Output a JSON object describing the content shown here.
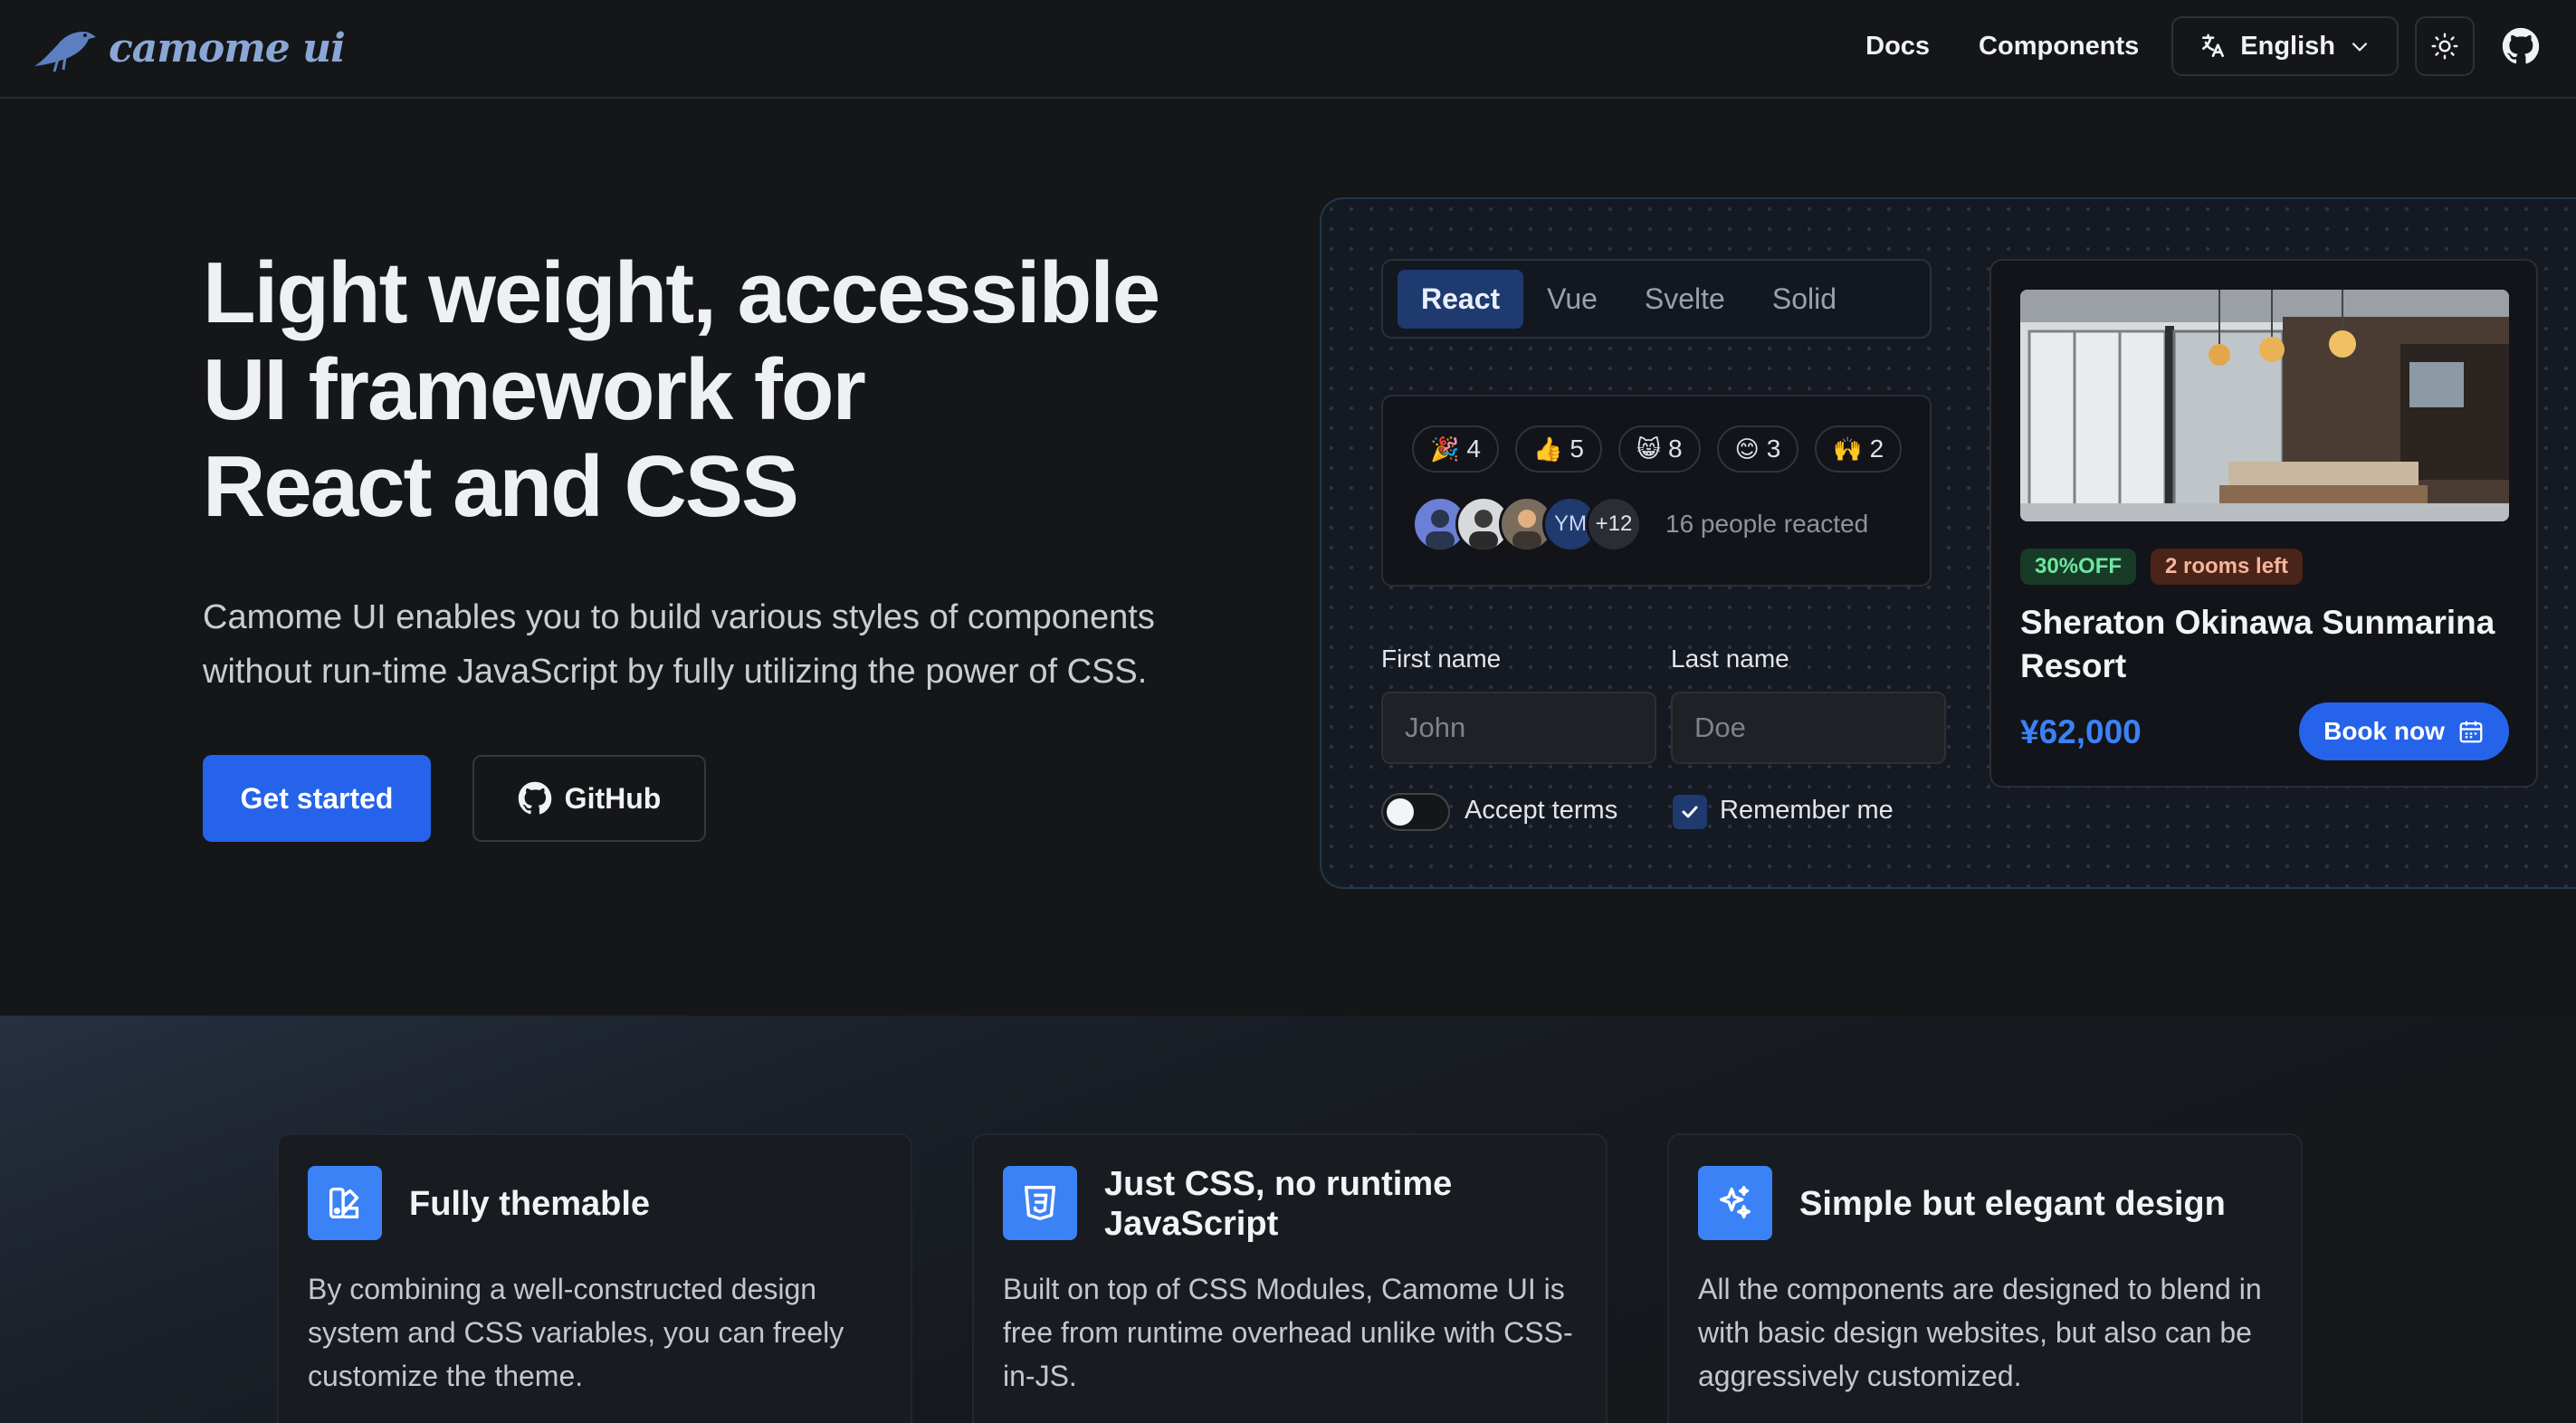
{
  "header": {
    "logo_text": "camome ui",
    "nav": {
      "docs": "Docs",
      "components": "Components",
      "language": "English"
    },
    "icons": [
      "translate-icon",
      "chevron-down-icon",
      "sun-icon",
      "github-icon"
    ]
  },
  "hero": {
    "title_line1": "Light weight, accessible",
    "title_line2": "UI framework for",
    "title_line3": "React and CSS",
    "description": "Camome UI enables you to build various styles of components without run-time JavaScript by fully utilizing the power of CSS.",
    "primary_button": "Get started",
    "secondary_button": "GitHub"
  },
  "demo": {
    "tabs": [
      {
        "label": "React",
        "active": true
      },
      {
        "label": "Vue",
        "active": false
      },
      {
        "label": "Svelte",
        "active": false
      },
      {
        "label": "Solid",
        "active": false
      }
    ],
    "reactions": [
      {
        "emoji": "🎉",
        "count": "4"
      },
      {
        "emoji": "👍",
        "count": "5"
      },
      {
        "emoji": "😸",
        "count": "8"
      },
      {
        "emoji": "😊",
        "count": "3"
      },
      {
        "emoji": "🙌",
        "count": "2"
      }
    ],
    "avatar_initials": "YM",
    "avatar_more": "+12",
    "reacted_text": "16 people reacted",
    "form": {
      "first_name_label": "First name",
      "first_name_placeholder": "John",
      "last_name_label": "Last name",
      "last_name_placeholder": "Doe",
      "accept_terms": "Accept terms",
      "remember_me": "Remember me",
      "accept_checked": false,
      "remember_checked": true
    },
    "hotel": {
      "discount_badge": "30%OFF",
      "rooms_badge": "2 rooms left",
      "name": "Sheraton Okinawa Sunmarina Resort",
      "price": "¥62,000",
      "book_button": "Book now"
    }
  },
  "features": [
    {
      "icon": "palette-icon",
      "title": "Fully themable",
      "description": "By combining a well-constructed design system and CSS variables, you can freely customize the theme."
    },
    {
      "icon": "css3-icon",
      "title": "Just CSS, no runtime JavaScript",
      "description": "Built on top of CSS Modules, Camome UI is free from runtime overhead unlike with CSS-in-JS."
    },
    {
      "icon": "sparkles-icon",
      "title": "Simple but elegant design",
      "description": "All the components are designed to blend in with basic design websites, but also can be aggressively customized."
    }
  ],
  "colors": {
    "accent": "#2563eb",
    "background": "#151618",
    "price": "#3b82f6",
    "discount_bg": "#173b27",
    "discount_fg": "#6ee7a0",
    "rooms_bg": "#4a2418",
    "rooms_fg": "#f5b59a"
  }
}
